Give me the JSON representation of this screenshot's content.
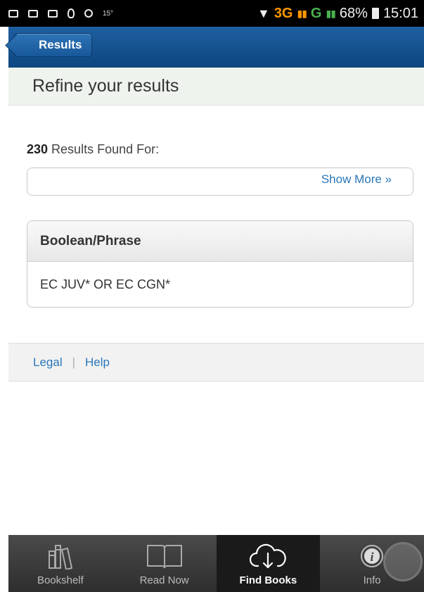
{
  "status_bar": {
    "small_label": "15°",
    "network_3g": "3G",
    "network_g": "G",
    "battery": "68%",
    "time": "15:01"
  },
  "header": {
    "back_label": "Results"
  },
  "refine": {
    "title": "Refine your results"
  },
  "results": {
    "count": "230",
    "label": " Results Found For:"
  },
  "query": {
    "show_more": "Show More »"
  },
  "panel": {
    "title": "Boolean/Phrase",
    "value": "EC JUV* OR EC CGN*"
  },
  "footer": {
    "legal": "Legal",
    "separator": "|",
    "help": "Help"
  },
  "tabs": [
    {
      "label": "Bookshelf",
      "icon": "bookshelf-icon"
    },
    {
      "label": "Read Now",
      "icon": "open-book-icon"
    },
    {
      "label": "Find Books",
      "icon": "cloud-download-icon",
      "active": true
    },
    {
      "label": "Info",
      "icon": "info-icon"
    }
  ]
}
